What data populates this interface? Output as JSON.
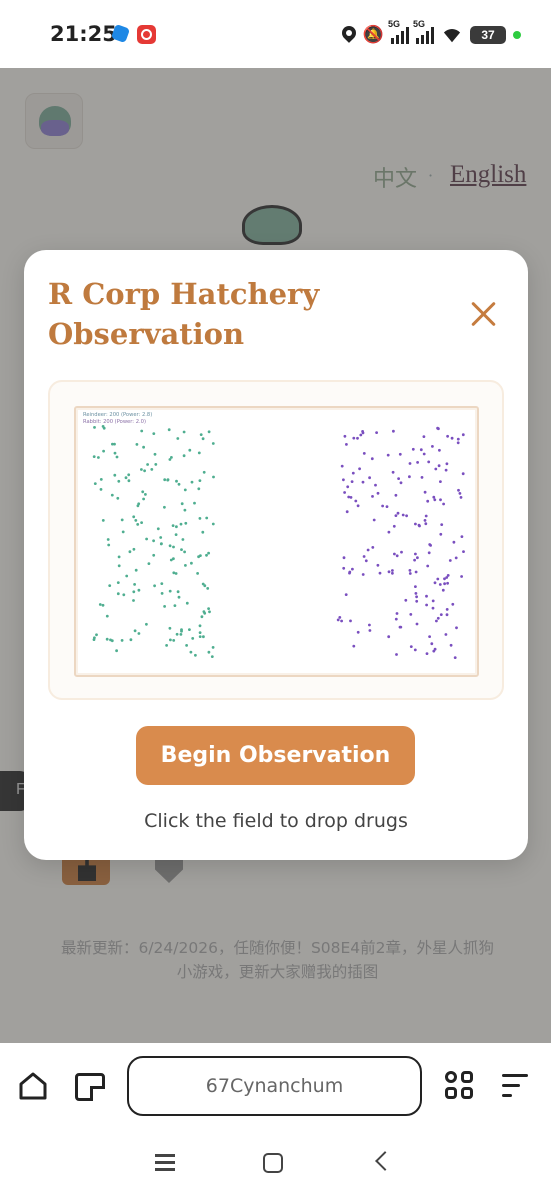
{
  "status_bar": {
    "time": "21:25",
    "battery": "37",
    "signal_1_label": "5G",
    "signal_2_label": "5G",
    "icons": [
      "location-icon",
      "mute-icon",
      "signal-icon",
      "wifi-icon",
      "battery-icon"
    ]
  },
  "page": {
    "lang_zh": "中文",
    "lang_separator": "·",
    "lang_en": "English",
    "side_tab": "F",
    "update_note": "最新更新：6/24/2026，任随你便！S08E4前2章，外星人抓狗小游戏，更新大家赠我的插图"
  },
  "modal": {
    "title": "R Corp Hatchery Observation",
    "close_icon": "close-icon",
    "stat_reindeer": "Reindeer: 200 (Power: 2.8)",
    "stat_rabbit": "Rabbit: 200 (Power: 2.0)",
    "begin_label": "Begin Observation",
    "hint": "Click the field to drop drugs"
  },
  "colors": {
    "accent": "#d98b4d",
    "title": "#bf7a3e",
    "reindeer_dot": "#4fae90",
    "rabbit_dot": "#7a4fbf"
  },
  "browser_bar": {
    "url": "67Cynanchum",
    "icons": [
      "home-icon",
      "tabs-icon",
      "apps-icon",
      "menu-icon"
    ]
  },
  "nav_bar": {
    "icons": [
      "recents-icon",
      "home-icon",
      "back-icon"
    ]
  }
}
